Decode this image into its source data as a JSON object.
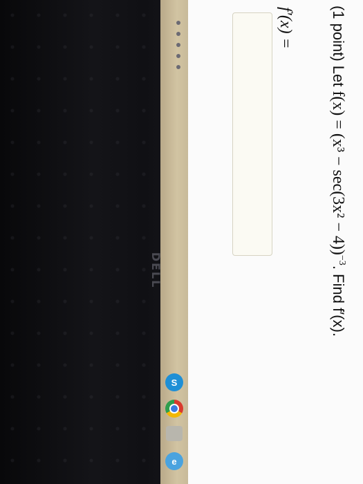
{
  "problem": {
    "points_label": "(1 point)",
    "text_let": "Let",
    "function_expression": "f(x) = (x³ − sec(3x² − 4))",
    "exponent": "−3",
    "text_find": ". Find f′(x)."
  },
  "answer": {
    "label": "f′(x) =",
    "value": ""
  },
  "taskbar": {
    "icons": [
      "skype-icon",
      "chrome-icon",
      "file-explorer-icon",
      "internet-explorer-icon"
    ],
    "skype_glyph": "S",
    "ie_glyph": "e"
  },
  "device": {
    "brand": "DELL"
  }
}
